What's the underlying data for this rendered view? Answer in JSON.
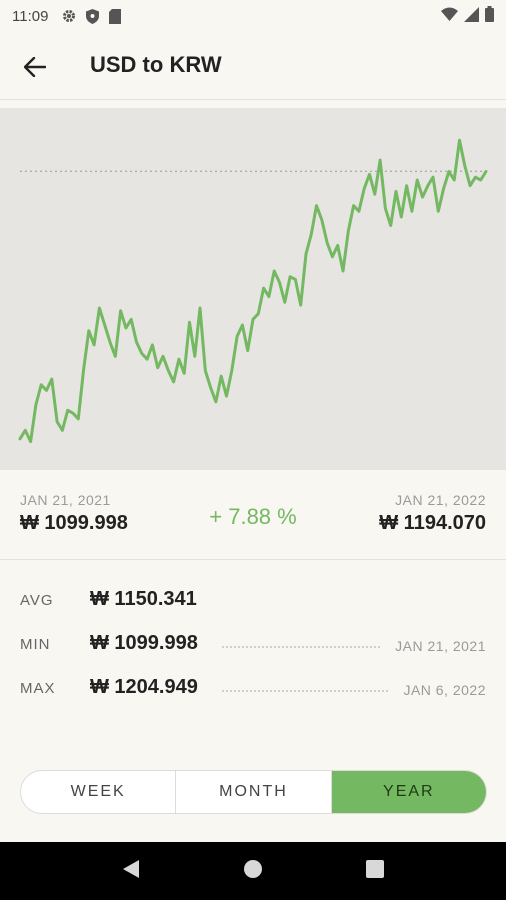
{
  "status_bar": {
    "time": "11:09"
  },
  "header": {
    "title": "USD to KRW"
  },
  "range": {
    "start_date": "JAN 21, 2021",
    "start_value": "₩ 1099.998",
    "change": "+ 7.88 %",
    "end_date": "JAN 21, 2022",
    "end_value": "₩ 1194.070"
  },
  "stats": {
    "avg": {
      "label": "AVG",
      "value": "₩ 1150.341"
    },
    "min": {
      "label": "MIN",
      "value": "₩ 1099.998",
      "date": "JAN 21, 2021"
    },
    "max": {
      "label": "MAX",
      "value": "₩ 1204.949",
      "date": "JAN 6, 2022"
    }
  },
  "periods": [
    {
      "label": "WEEK",
      "active": false
    },
    {
      "label": "MONTH",
      "active": false
    },
    {
      "label": "YEAR",
      "active": true
    }
  ],
  "colors": {
    "accent": "#74b862",
    "chart_bg": "#e6e5e2",
    "background": "#f9f7f2"
  },
  "chart_data": {
    "type": "line",
    "ylim": [
      1095,
      1210
    ],
    "reference_line": 1194.07,
    "series": [
      {
        "values": [
          1100,
          1103,
          1099,
          1112,
          1119,
          1117,
          1121,
          1106,
          1103,
          1110,
          1109,
          1107,
          1124,
          1138,
          1133,
          1146,
          1140,
          1134,
          1129,
          1145,
          1139,
          1142,
          1134,
          1130,
          1128,
          1133,
          1125,
          1129,
          1124,
          1120,
          1128,
          1123,
          1141,
          1129,
          1146,
          1124,
          1118,
          1113,
          1122,
          1115,
          1124,
          1136,
          1140,
          1131,
          1142,
          1144,
          1153,
          1150,
          1159,
          1155,
          1148,
          1157,
          1156,
          1147,
          1165,
          1172,
          1182,
          1177,
          1169,
          1164,
          1168,
          1159,
          1173,
          1182,
          1180,
          1188,
          1193,
          1186,
          1198,
          1181,
          1175,
          1187,
          1178,
          1189,
          1180,
          1191,
          1185,
          1189,
          1192,
          1180,
          1188,
          1194,
          1191,
          1205,
          1196,
          1189,
          1192,
          1191,
          1194
        ]
      }
    ]
  }
}
